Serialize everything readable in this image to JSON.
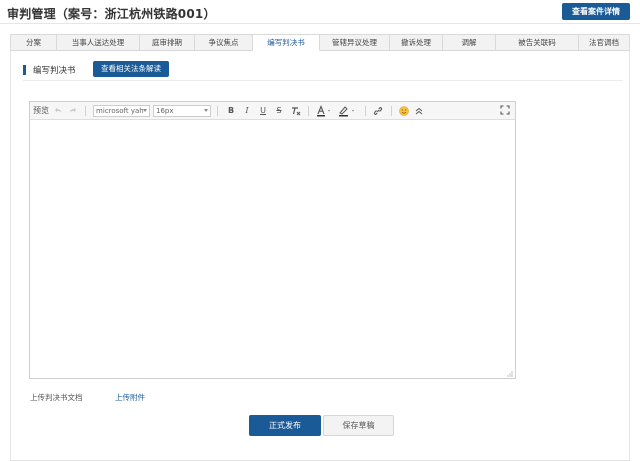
{
  "header": {
    "title": "审判管理（案号：浙江杭州铁路001）",
    "case_detail_label": "查看案件详情"
  },
  "tabs": [
    {
      "label": "分案",
      "active": false
    },
    {
      "label": "当事人送达处理",
      "active": false
    },
    {
      "label": "庭审排期",
      "active": false
    },
    {
      "label": "争议焦点",
      "active": false
    },
    {
      "label": "编写判决书",
      "active": true
    },
    {
      "label": "管辖异议处理",
      "active": false
    },
    {
      "label": "撤诉处理",
      "active": false
    },
    {
      "label": "调解",
      "active": false
    },
    {
      "label": "被告关联码",
      "active": false
    },
    {
      "label": "法官调档",
      "active": false
    }
  ],
  "section": {
    "title": "编写判决书",
    "law_button_label": "查看相关法条解读"
  },
  "editor": {
    "toolbar": {
      "preview_label": "预览",
      "font_family": "microsoft yah",
      "font_size": "16px"
    },
    "content": ""
  },
  "upload": {
    "label": "上传判决书文档",
    "link_label": "上传附件"
  },
  "actions": {
    "publish_label": "正式发布",
    "save_draft_label": "保存草稿"
  },
  "colors": {
    "brand": "#1a5a96",
    "tab_background": "#f2f2f2",
    "border": "#d9d9d9"
  }
}
